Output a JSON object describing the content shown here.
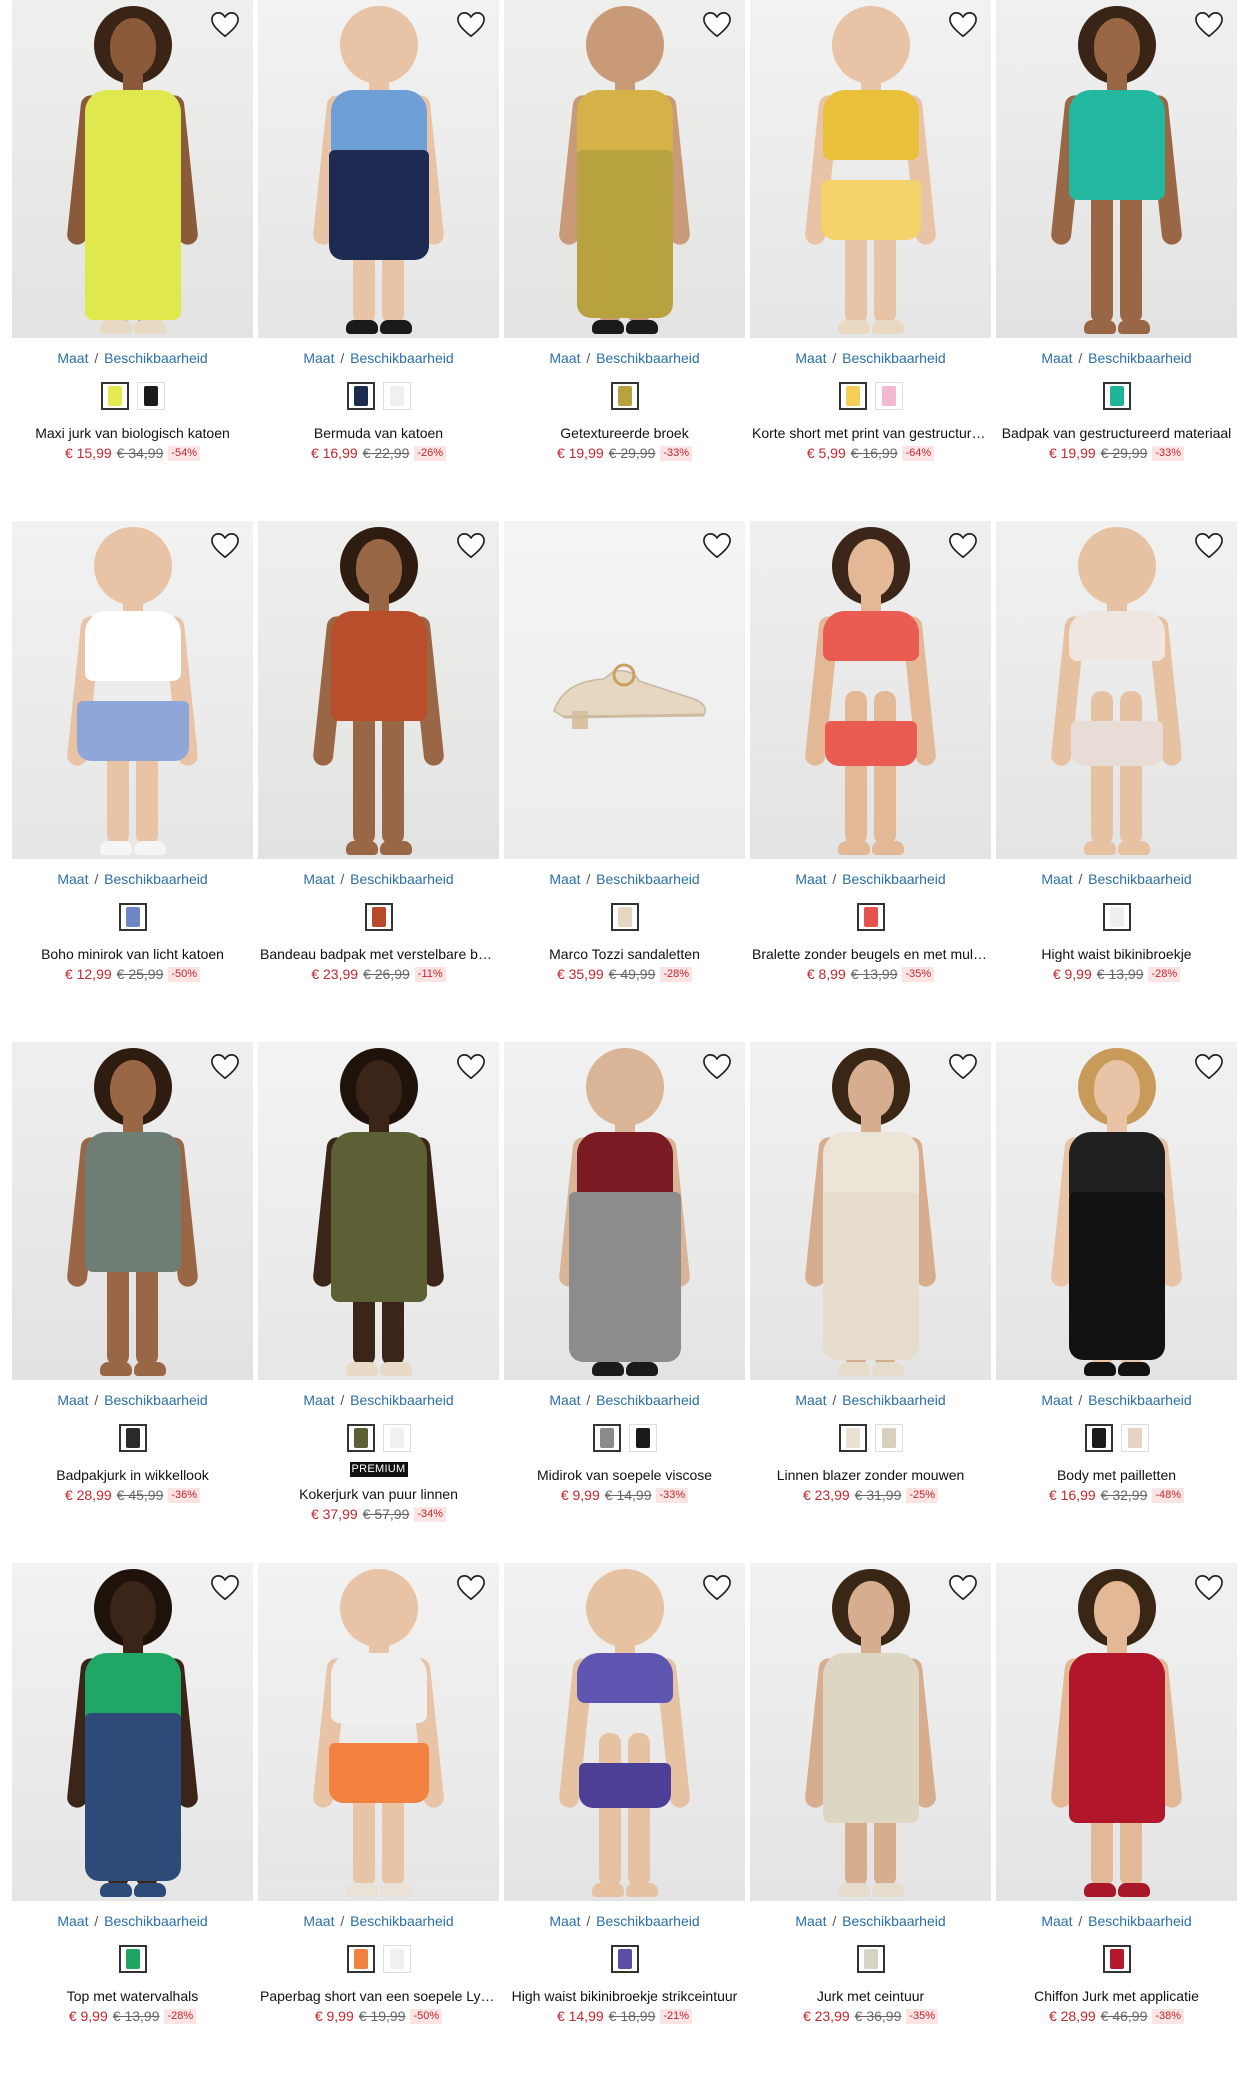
{
  "common": {
    "size_label": "Maat",
    "availability_label": "Beschikbaarheid",
    "separator": "/"
  },
  "products": [
    {
      "name": "Maxi jurk van biologisch katoen",
      "price": "€ 15,99",
      "old_price": "€ 34,99",
      "discount": "-54%",
      "swatches": [
        "#e4ea4f",
        "#1a1a1a"
      ],
      "figure": {
        "kind": "dress",
        "c1": "#dfe84c",
        "c2": "#dfe84c",
        "skin": "#8a5a3b",
        "hair": "#3a2415",
        "shoe": "#e8d9c5",
        "bg1": "#efefed",
        "bg2": "#e3e3e1",
        "length": "long"
      }
    },
    {
      "name": "Bermuda van katoen",
      "price": "€ 16,99",
      "old_price": "€ 22,99",
      "discount": "-26%",
      "swatches": [
        "#1c2a4f",
        "#f0f0f0"
      ],
      "figure": {
        "kind": "shorts",
        "c1": "#6e9fd6",
        "c2": "#1d2b52",
        "skin": "#e8c3a6",
        "hair": "#e8c3a6",
        "shoe": "#1a1a1a",
        "bg1": "#f2f2f2",
        "bg2": "#e5e5e5",
        "length": "knee"
      }
    },
    {
      "name": "Getextureerde broek",
      "price": "€ 19,99",
      "old_price": "€ 29,99",
      "discount": "-33%",
      "swatches": [
        "#b8a23f"
      ],
      "figure": {
        "kind": "pants",
        "c1": "#d4b247",
        "c2": "#b8a23f",
        "skin": "#c99a78",
        "hair": "#c99a78",
        "shoe": "#1a1a1a",
        "bg1": "#efefed",
        "bg2": "#e3e3e1",
        "length": "long"
      }
    },
    {
      "name": "Korte short met print van gestructureerde stof",
      "price": "€ 5,99",
      "old_price": "€ 16,99",
      "discount": "-64%",
      "swatches": [
        "#f3cf55",
        "#f2b8cf"
      ],
      "figure": {
        "kind": "shorts",
        "c1": "#e9c03a",
        "c2": "#f3d36a",
        "skin": "#e8c3a6",
        "hair": "#e8c3a6",
        "shoe": "#e9d8c2",
        "bg1": "#f2f2f2",
        "bg2": "#e6e6e6",
        "length": "short"
      }
    },
    {
      "name": "Badpak van gestructureerd materiaal",
      "price": "€ 19,99",
      "old_price": "€ 29,99",
      "discount": "-33%",
      "swatches": [
        "#1fb59a"
      ],
      "figure": {
        "kind": "swim",
        "c1": "#24b8a0",
        "c2": "#24b8a0",
        "skin": "#9a6746",
        "hair": "#3a2415",
        "shoe": "#9a6746",
        "bg1": "#f0f0f0",
        "bg2": "#e2e2e2",
        "length": "none"
      }
    },
    {
      "name": "Boho minirok van licht katoen",
      "price": "€ 12,99",
      "old_price": "€ 25,99",
      "discount": "-50%",
      "swatches": [
        "#6d86c4"
      ],
      "figure": {
        "kind": "skirt",
        "c1": "#ffffff",
        "c2": "#8ea6d8",
        "skin": "#e8c3a6",
        "hair": "#e8c3a6",
        "shoe": "#f5f5f5",
        "bg1": "#f2f2f2",
        "bg2": "#e6e6e6",
        "length": "short"
      }
    },
    {
      "name": "Bandeau badpak met verstelbare bandjes",
      "price": "€ 23,99",
      "old_price": "€ 26,99",
      "discount": "-11%",
      "swatches": [
        "#b8492a"
      ],
      "figure": {
        "kind": "swim",
        "c1": "#b84e2c",
        "c2": "#b84e2c",
        "skin": "#9a6746",
        "hair": "#2e1c10",
        "shoe": "#9a6746",
        "bg1": "#efefed",
        "bg2": "#e2e2e0",
        "length": "none"
      }
    },
    {
      "name": "Marco Tozzi sandaletten",
      "price": "€ 35,99",
      "old_price": "€ 49,99",
      "discount": "-28%",
      "swatches": [
        "#e6d7c3"
      ],
      "figure": {
        "kind": "shoe",
        "c1": "#e6d7c3",
        "c2": "#d9c2a0",
        "skin": "#e6d7c3",
        "hair": "#e6d7c3",
        "shoe": "#e6d7c3",
        "bg1": "#f4f4f4",
        "bg2": "#ececec",
        "length": "none"
      }
    },
    {
      "name": "Bralette zonder beugels en met multiway bandjes",
      "price": "€ 8,99",
      "old_price": "€ 13,99",
      "discount": "-35%",
      "swatches": [
        "#e5534c"
      ],
      "figure": {
        "kind": "lingerie",
        "c1": "#ea5b52",
        "c2": "#ea5b52",
        "skin": "#e3b896",
        "hair": "#3b2619",
        "shoe": "#e3b896",
        "bg1": "#efefef",
        "bg2": "#e3e3e3",
        "length": "none"
      }
    },
    {
      "name": "Hight waist bikinibroekje",
      "price": "€ 9,99",
      "old_price": "€ 13,99",
      "discount": "-28%",
      "swatches": [
        "#efefef"
      ],
      "figure": {
        "kind": "lingerie",
        "c1": "#efe6e2",
        "c2": "#e8dcd6",
        "skin": "#e6c2a3",
        "hair": "#e6c2a3",
        "shoe": "#e6c2a3",
        "bg1": "#f1f1f1",
        "bg2": "#e4e4e4",
        "length": "none"
      }
    },
    {
      "name": "Badpakjurk in wikkellook",
      "price": "€ 28,99",
      "old_price": "€ 45,99",
      "discount": "-36%",
      "swatches": [
        "#2a2a2a"
      ],
      "figure": {
        "kind": "dress",
        "c1": "#6f7e74",
        "c2": "#1c1c1c",
        "skin": "#9a6746",
        "hair": "#2e1c10",
        "shoe": "#9a6746",
        "bg1": "#efefef",
        "bg2": "#e2e2e2",
        "length": "mini"
      }
    },
    {
      "name": "Kokerjurk van puur linnen",
      "price": "€ 37,99",
      "old_price": "€ 57,99",
      "discount": "-34%",
      "badge": "PREMIUM",
      "swatches": [
        "#5c5e33",
        "#f0f0f0"
      ],
      "figure": {
        "kind": "dress",
        "c1": "#5d5f35",
        "c2": "#5d5f35",
        "skin": "#3b2418",
        "hair": "#1e120a",
        "shoe": "#e7dbc7",
        "bg1": "#f3f3f3",
        "bg2": "#e7e7e7",
        "length": "knee"
      }
    },
    {
      "name": "Midirok van soepele viscose",
      "price": "€ 9,99",
      "old_price": "€ 14,99",
      "discount": "-33%",
      "swatches": [
        "#8b8b8b",
        "#1a1a1a"
      ],
      "figure": {
        "kind": "skirt",
        "c1": "#7a1b24",
        "c2": "#8c8c8c",
        "skin": "#d9b496",
        "hair": "#d9b496",
        "shoe": "#1a1a1a",
        "bg1": "#f1f1f1",
        "bg2": "#e4e4e4",
        "length": "long"
      }
    },
    {
      "name": "Linnen blazer zonder mouwen",
      "price": "€ 23,99",
      "old_price": "€ 31,99",
      "discount": "-25%",
      "swatches": [
        "#e8e1d4",
        "#d9cfbe"
      ],
      "figure": {
        "kind": "pants",
        "c1": "#ece4d6",
        "c2": "#e5dccb",
        "skin": "#d6ad8e",
        "hair": "#3a2615",
        "shoe": "#e5dccb",
        "bg1": "#f1f1f1",
        "bg2": "#e4e4e4",
        "length": "long"
      }
    },
    {
      "name": "Body met pailletten",
      "price": "€ 16,99",
      "old_price": "€ 32,99",
      "discount": "-48%",
      "swatches": [
        "#1a1a1a",
        "#e7d3c2"
      ],
      "figure": {
        "kind": "pants",
        "c1": "#202020",
        "c2": "#111111",
        "skin": "#e8c3a6",
        "hair": "#c99b5a",
        "shoe": "#111111",
        "bg1": "#f1f1f1",
        "bg2": "#e4e4e4",
        "length": "long"
      }
    },
    {
      "name": "Top met watervalhals",
      "price": "€ 9,99",
      "old_price": "€ 13,99",
      "discount": "-28%",
      "swatches": [
        "#1fa462"
      ],
      "figure": {
        "kind": "pants",
        "c1": "#21a765",
        "c2": "#2d4a78",
        "skin": "#3b2418",
        "hair": "#1e120a",
        "shoe": "#2d4a78",
        "bg1": "#f2f2f2",
        "bg2": "#e5e5e5",
        "length": "long"
      }
    },
    {
      "name": "Paperbag short van een soepele Lyocell-blend",
      "price": "€ 9,99",
      "old_price": "€ 19,99",
      "discount": "-50%",
      "swatches": [
        "#f0813f",
        "#f0f0f0"
      ],
      "figure": {
        "kind": "shorts",
        "c1": "#efefef",
        "c2": "#f2813f",
        "skin": "#e8c3a6",
        "hair": "#e8c3a6",
        "shoe": "#eae2d6",
        "bg1": "#f2f2f2",
        "bg2": "#e6e6e6",
        "length": "short"
      }
    },
    {
      "name": "High waist bikinibroekje strikceintuur",
      "price": "€ 14,99",
      "old_price": "€ 18,99",
      "discount": "-21%",
      "swatches": [
        "#5b4fa3"
      ],
      "figure": {
        "kind": "lingerie",
        "c1": "#5e56b0",
        "c2": "#4b3f96",
        "skin": "#e6c2a3",
        "hair": "#e6c2a3",
        "shoe": "#e6c2a3",
        "bg1": "#f1f1f1",
        "bg2": "#e4e4e4",
        "length": "none"
      }
    },
    {
      "name": "Jurk met ceintuur",
      "price": "€ 23,99",
      "old_price": "€ 36,99",
      "discount": "-35%",
      "swatches": [
        "#d7d3c4"
      ],
      "figure": {
        "kind": "dress",
        "c1": "#dcd6c2",
        "c2": "#cfc8ae",
        "skin": "#d6ad8e",
        "hair": "#3a2615",
        "shoe": "#e5dccb",
        "bg1": "#f1f1f1",
        "bg2": "#e4e4e4",
        "length": "knee"
      }
    },
    {
      "name": "Chiffon Jurk met applicatie",
      "price": "€ 28,99",
      "old_price": "€ 46,99",
      "discount": "-38%",
      "swatches": [
        "#b3182c"
      ],
      "figure": {
        "kind": "dress",
        "c1": "#b1162a",
        "c2": "#a8172a",
        "skin": "#e3b896",
        "hair": "#3a2615",
        "shoe": "#a8172a",
        "bg1": "#f1f1f1",
        "bg2": "#e4e4e4",
        "length": "knee"
      }
    }
  ]
}
